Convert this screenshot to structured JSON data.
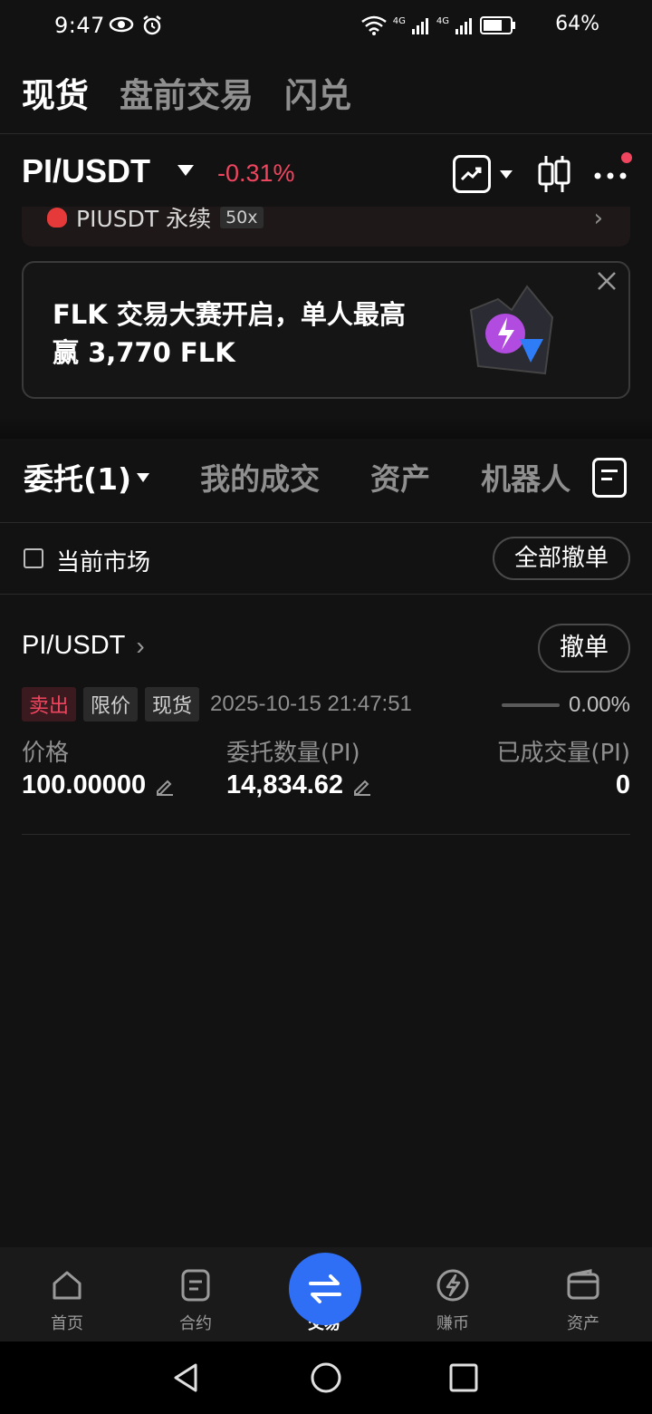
{
  "status_bar": {
    "time": "9:47",
    "battery": "64%",
    "net_label_1": "4G",
    "net_label_2": "4G"
  },
  "top_tabs": [
    "现货",
    "盘前交易",
    "闪兑"
  ],
  "pair": {
    "name": "PI/USDT",
    "change": "-0.31%",
    "change_color": "#f0455f"
  },
  "perp_strip": {
    "text": "PIUSDT 永续",
    "leverage": "50x"
  },
  "banner": {
    "text": "FLK 交易大赛开启，单人最高赢 3,770 FLK"
  },
  "order_tabs": {
    "active": "委托(1)",
    "items": [
      "我的成交",
      "资产",
      "机器人"
    ]
  },
  "filter": {
    "checkbox_label": "当前市场",
    "cancel_all_label": "全部撤单"
  },
  "order": {
    "pair": "PI/USDT",
    "cancel_label": "撤单",
    "side": "卖出",
    "type": "限价",
    "market": "现货",
    "time": "2025-10-15 21:47:51",
    "filled_percent": "0.00%",
    "price_label": "价格",
    "price": "100.00000",
    "amount_label": "委托数量(PI)",
    "amount": "14,834.62",
    "filled_label": "已成交量(PI)",
    "filled": "0"
  },
  "bottom_nav": [
    {
      "label": "首页",
      "icon": "home-icon"
    },
    {
      "label": "合约",
      "icon": "contract-icon"
    },
    {
      "label": "交易",
      "icon": "swap-icon",
      "active": true
    },
    {
      "label": "赚币",
      "icon": "earn-icon"
    },
    {
      "label": "资产",
      "icon": "wallet-icon"
    }
  ],
  "colors": {
    "background": "#121212",
    "accent_blue": "#2f6ff6",
    "sell_red": "#f0455f"
  }
}
